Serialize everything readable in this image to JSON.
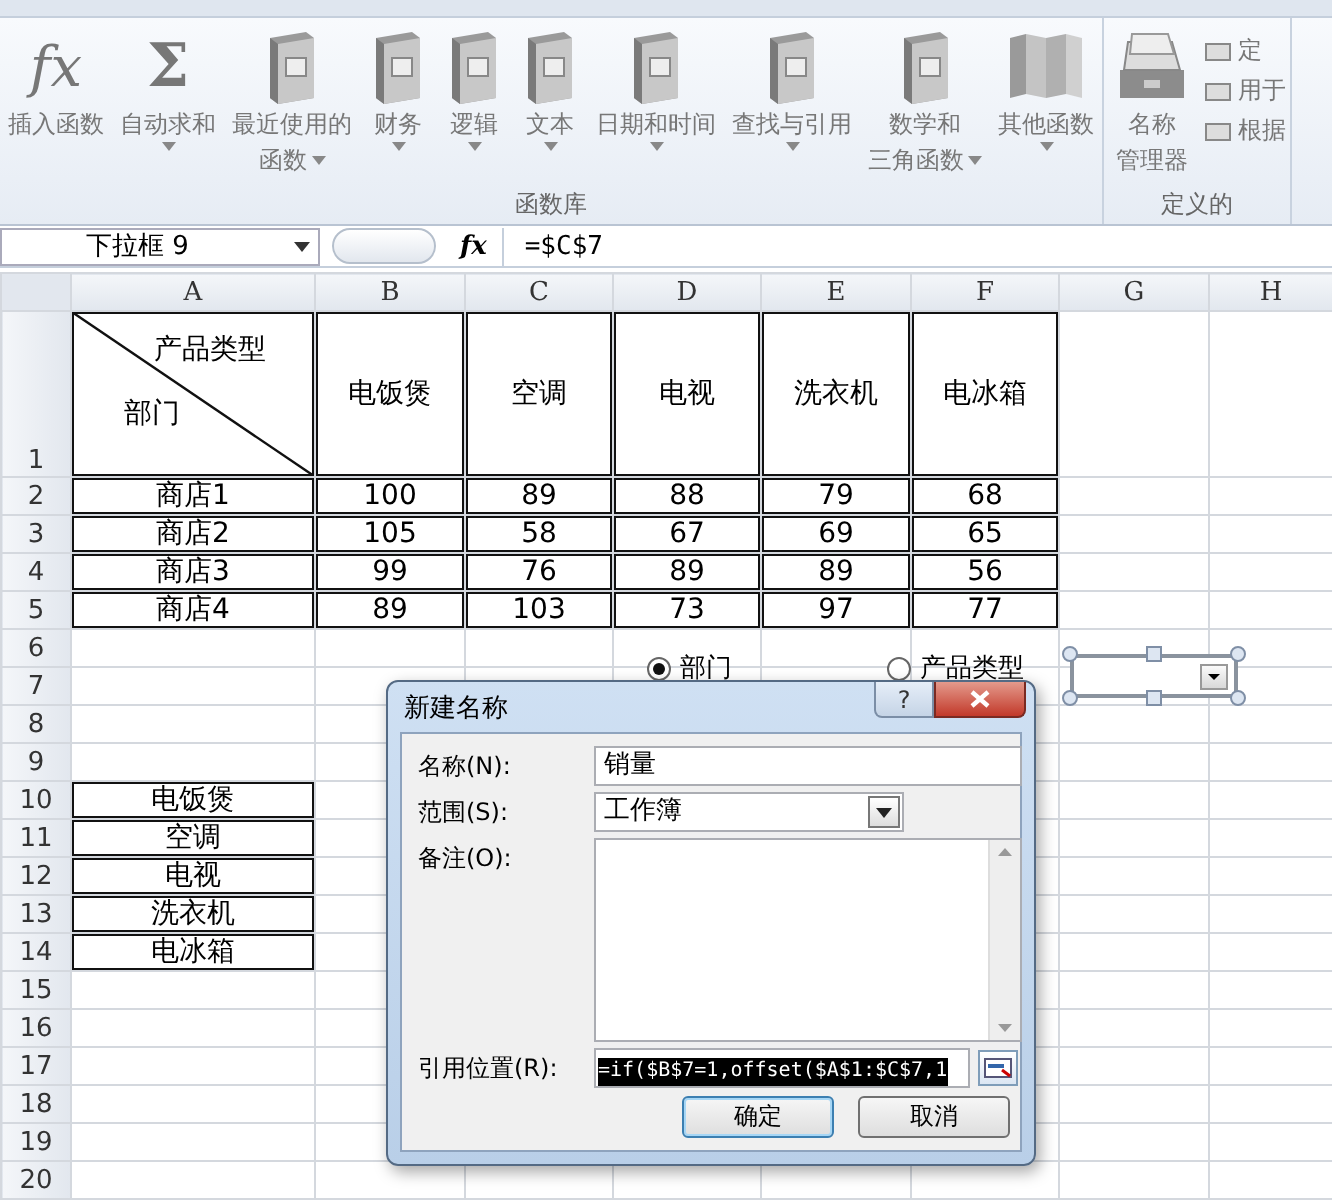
{
  "ribbon": {
    "groups": [
      {
        "label": "函数库",
        "buttons": [
          {
            "kind": "glyph",
            "glyph": "fx",
            "lines": [
              "插入函数"
            ],
            "dropdown": false
          },
          {
            "kind": "glyph",
            "glyph": "Σ",
            "lines": [
              "自动求和"
            ],
            "dropdown": true
          },
          {
            "kind": "book",
            "lines": [
              "最近使用的",
              "函数"
            ],
            "dropdown": true
          },
          {
            "kind": "book",
            "lines": [
              "财务"
            ],
            "dropdown": true
          },
          {
            "kind": "book",
            "lines": [
              "逻辑"
            ],
            "dropdown": true
          },
          {
            "kind": "book",
            "lines": [
              "文本"
            ],
            "dropdown": true
          },
          {
            "kind": "book",
            "lines": [
              "日期和时间"
            ],
            "dropdown": true
          },
          {
            "kind": "book",
            "lines": [
              "查找与引用"
            ],
            "dropdown": true
          },
          {
            "kind": "book",
            "lines": [
              "数学和",
              "三角函数"
            ],
            "dropdown": true
          },
          {
            "kind": "books",
            "lines": [
              "其他函数"
            ],
            "dropdown": true
          }
        ]
      },
      {
        "label": "定义的",
        "buttons": [
          {
            "kind": "cards",
            "lines": [
              "名称",
              "管理器"
            ],
            "dropdown": false
          }
        ],
        "small_buttons": [
          {
            "label": "定"
          },
          {
            "label": "用于"
          },
          {
            "label": "根据"
          }
        ]
      }
    ]
  },
  "formula_bar": {
    "name_box": "下拉框 9",
    "fx": "fx",
    "formula": "=$C$7"
  },
  "sheet": {
    "columns": [
      "A",
      "B",
      "C",
      "D",
      "E",
      "F",
      "G",
      "H"
    ],
    "rows": [
      {
        "header": "1",
        "cells": [
          {
            "kind": "diagonal",
            "top": "产品类型",
            "bottom": "部门",
            "boxed": true
          },
          {
            "text": "电饭煲",
            "boxed": true
          },
          {
            "text": "空调",
            "boxed": true
          },
          {
            "text": "电视",
            "boxed": true
          },
          {
            "text": "洗衣机",
            "boxed": true
          },
          {
            "text": "电冰箱",
            "boxed": true
          }
        ]
      },
      {
        "header": "2",
        "cells": [
          {
            "text": "商店1",
            "boxed": true
          },
          {
            "text": "100",
            "boxed": true
          },
          {
            "text": "89",
            "boxed": true
          },
          {
            "text": "88",
            "boxed": true
          },
          {
            "text": "79",
            "boxed": true
          },
          {
            "text": "68",
            "boxed": true
          }
        ]
      },
      {
        "header": "3",
        "cells": [
          {
            "text": "商店2",
            "boxed": true
          },
          {
            "text": "105",
            "boxed": true
          },
          {
            "text": "58",
            "boxed": true
          },
          {
            "text": "67",
            "boxed": true
          },
          {
            "text": "69",
            "boxed": true
          },
          {
            "text": "65",
            "boxed": true
          }
        ]
      },
      {
        "header": "4",
        "cells": [
          {
            "text": "商店3",
            "boxed": true
          },
          {
            "text": "99",
            "boxed": true
          },
          {
            "text": "76",
            "boxed": true
          },
          {
            "text": "89",
            "boxed": true
          },
          {
            "text": "89",
            "boxed": true
          },
          {
            "text": "56",
            "boxed": true
          }
        ]
      },
      {
        "header": "5",
        "cells": [
          {
            "text": "商店4",
            "boxed": true
          },
          {
            "text": "89",
            "boxed": true
          },
          {
            "text": "103",
            "boxed": true
          },
          {
            "text": "73",
            "boxed": true
          },
          {
            "text": "97",
            "boxed": true
          },
          {
            "text": "77",
            "boxed": true
          }
        ]
      },
      {
        "header": "6"
      },
      {
        "header": "7"
      },
      {
        "header": "8"
      },
      {
        "header": "9"
      },
      {
        "header": "10",
        "cells": [
          {
            "text": "电饭煲",
            "boxed": true
          }
        ]
      },
      {
        "header": "11",
        "cells": [
          {
            "text": "空调",
            "boxed": true
          }
        ]
      },
      {
        "header": "12",
        "cells": [
          {
            "text": "电视",
            "boxed": true
          }
        ]
      },
      {
        "header": "13",
        "cells": [
          {
            "text": "洗衣机",
            "boxed": true
          }
        ]
      },
      {
        "header": "14",
        "cells": [
          {
            "text": "电冰箱",
            "boxed": true
          }
        ]
      },
      {
        "header": "15"
      },
      {
        "header": "16"
      },
      {
        "header": "17"
      },
      {
        "header": "18"
      },
      {
        "header": "19"
      },
      {
        "header": "20"
      }
    ],
    "radios": [
      {
        "text": "部门",
        "selected": true
      },
      {
        "text": "产品类型",
        "selected": false
      }
    ],
    "dropdown_control": {
      "selected": true
    }
  },
  "dialog": {
    "title": "新建名称",
    "help": "?",
    "fields": [
      {
        "kind": "text",
        "label": "名称(N):",
        "value": "销量"
      },
      {
        "kind": "dropdown",
        "label": "范围(S):",
        "value": "工作簿"
      },
      {
        "kind": "textarea",
        "label": "备注(O):"
      },
      {
        "kind": "reference",
        "label": "引用位置(R):",
        "value": "=if($B$7=1,offset($A$1:$C$7,1",
        "text_selected": true
      }
    ],
    "buttons": [
      {
        "label": "确定",
        "default": true
      },
      {
        "label": "取消",
        "default": false
      }
    ]
  }
}
